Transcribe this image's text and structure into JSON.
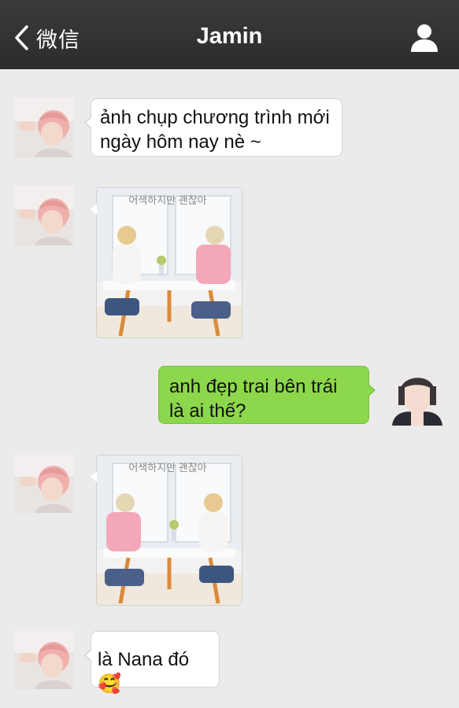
{
  "header": {
    "back_label": "微信",
    "title": "Jamin",
    "profile_icon": "person-icon",
    "background": "#2f2f2f"
  },
  "messages": [
    {
      "side": "left",
      "type": "text",
      "text_line1": "ảnh chụp chương trình mới",
      "text_line2": "ngày hôm nay nè ~"
    },
    {
      "side": "left",
      "type": "image",
      "caption": "어색하지만 괜찮아"
    },
    {
      "side": "right",
      "type": "text",
      "text_line1": "anh đẹp trai bên trái",
      "text_line2": "là ai thế?",
      "bubble_color": "#8dd74c"
    },
    {
      "side": "left",
      "type": "image",
      "caption": "어색하지만 괜찮아"
    },
    {
      "side": "left",
      "type": "text",
      "text_line1": "là Nana đó",
      "emoji": "🥰"
    }
  ],
  "colors": {
    "chat_background": "#ebebeb",
    "outgoing_bubble": "#8dd74c",
    "incoming_bubble": "#ffffff"
  }
}
